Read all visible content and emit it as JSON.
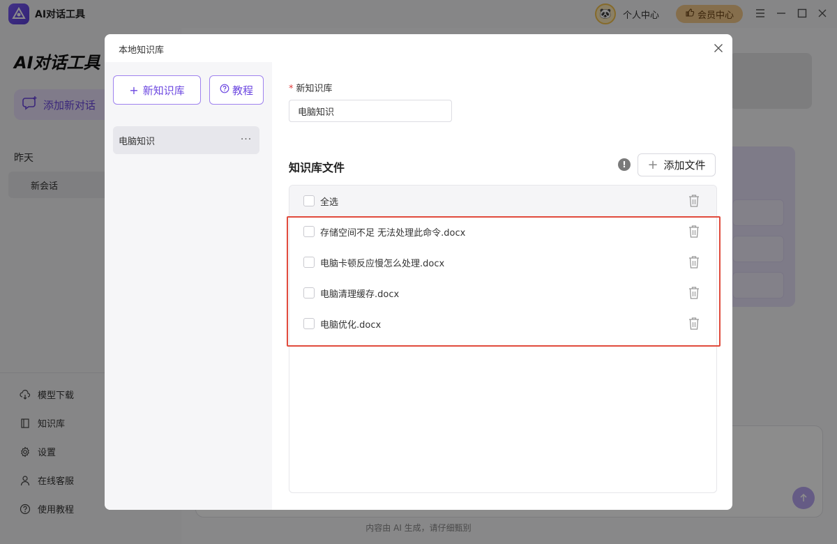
{
  "app": {
    "name": "AI对话工具",
    "user_center": "个人中心",
    "vip_label": "会员中心"
  },
  "sidebar": {
    "brand_title": "AI对话工具",
    "add_chat_label": "添加新对话",
    "section_label": "昨天",
    "session_label": "新会话",
    "nav": [
      {
        "label": "模型下载",
        "icon": "cloud-download-icon"
      },
      {
        "label": "知识库",
        "icon": "book-icon"
      },
      {
        "label": "设置",
        "icon": "gear-icon"
      },
      {
        "label": "在线客服",
        "icon": "user-icon"
      },
      {
        "label": "使用教程",
        "icon": "help-circle-icon"
      }
    ]
  },
  "footer_note": "内容由 AI 生成，请仔细甄别",
  "modal": {
    "title": "本地知识库",
    "new_kb_label": "新知识库",
    "tutorial_label": "教程",
    "kb_list": [
      {
        "label": "电脑知识"
      }
    ],
    "form": {
      "required_mark": "*",
      "name_label": "新知识库",
      "name_value": "电脑知识"
    },
    "files_heading": "知识库文件",
    "add_file_label": "添加文件",
    "select_all_label": "全选",
    "files": [
      {
        "name": "存储空间不足 无法处理此命令.docx"
      },
      {
        "name": "电脑卡顿反应慢怎么处理.docx"
      },
      {
        "name": "电脑清理缓存.docx"
      },
      {
        "name": "电脑优化.docx"
      }
    ]
  },
  "colors": {
    "accent": "#6b46e0",
    "accent_border": "#9f82ee",
    "highlight": "#e04a3c",
    "vip": "#f3c98a"
  }
}
